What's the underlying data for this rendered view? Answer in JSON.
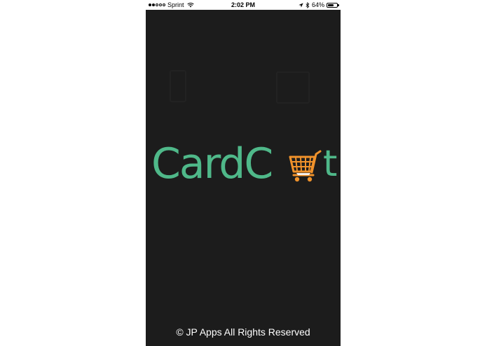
{
  "status_bar": {
    "carrier": "Sprint",
    "time": "2:02 PM",
    "battery_percent": "64%",
    "battery_level": 0.64,
    "signal_filled": 2,
    "signal_total": 5,
    "icons": [
      "wifi-icon",
      "location-arrow-icon",
      "bluetooth-icon",
      "battery-icon"
    ]
  },
  "splash": {
    "logo_text": "CardC",
    "logo_text_end": "t",
    "logo_color": "#4fb889",
    "cart_color": "#f0922b",
    "background_color": "#1c1c1c"
  },
  "footer": {
    "copyright": "© JP Apps All Rights Reserved"
  }
}
